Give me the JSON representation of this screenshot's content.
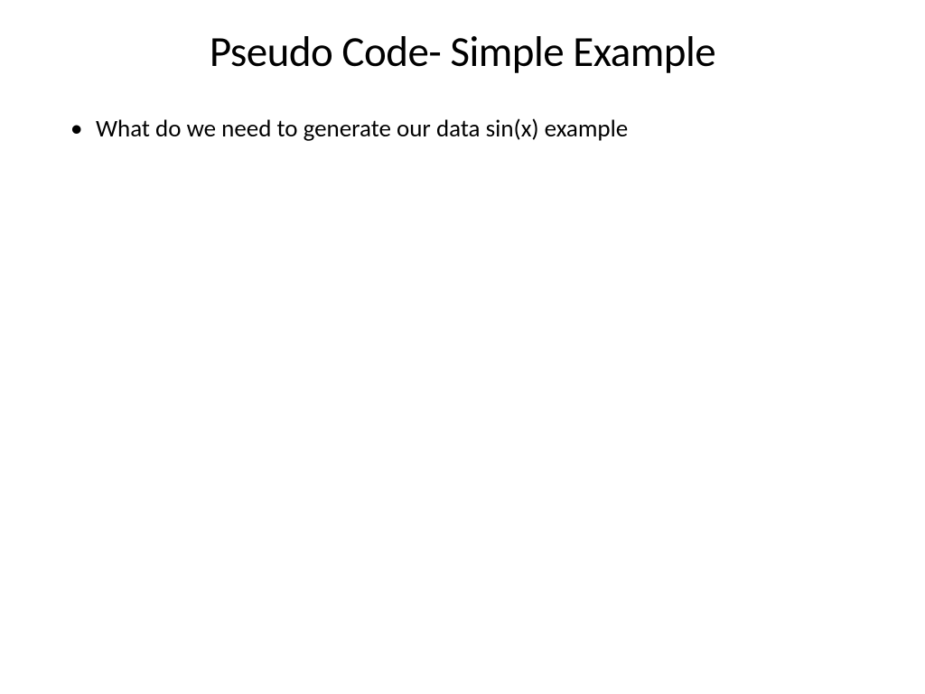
{
  "slide": {
    "title": "Pseudo Code- Simple Example",
    "bullets": [
      "What do we need to generate our data sin(x) example"
    ]
  }
}
